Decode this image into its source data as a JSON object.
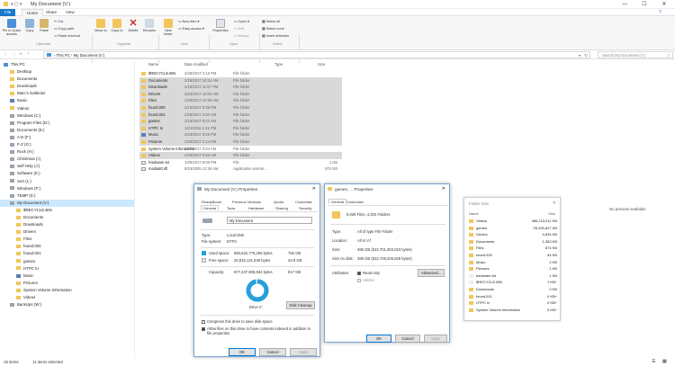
{
  "window": {
    "title": "My Document (V:)",
    "minimize": "—",
    "maximize": "☐",
    "close": "✕"
  },
  "tabs": [
    "File",
    "Home",
    "Share",
    "View"
  ],
  "ribbon": {
    "pin": "Pin to Quick access",
    "copy": "Copy",
    "paste": "Paste",
    "cut": "Cut",
    "copy_path": "Copy path",
    "paste_shortcut": "Paste shortcut",
    "move_to": "Move to",
    "copy_to": "Copy to",
    "delete": "Delete",
    "rename": "Rename",
    "new_folder": "New folder",
    "new_item": "New item ▾",
    "easy_access": "Easy access ▾",
    "properties": "Properties",
    "open": "Open ▾",
    "edit": "Edit",
    "history": "History",
    "select_all": "Select all",
    "select_none": "Select none",
    "invert_selection": "Invert selection",
    "groups": [
      "Clipboard",
      "Organize",
      "New",
      "Open",
      "Select"
    ]
  },
  "address": {
    "path": "› This PC › My Document (V:)",
    "search_placeholder": "Search My Document (V:)"
  },
  "nav": [
    {
      "label": "This PC",
      "kind": "pc",
      "indent": 0
    },
    {
      "label": "Desktop",
      "kind": "folder",
      "indent": 1
    },
    {
      "label": "Documents",
      "kind": "folder",
      "indent": 1
    },
    {
      "label": "Downloads",
      "kind": "folder",
      "indent": 1
    },
    {
      "label": "Marc's Galleries",
      "kind": "folder",
      "indent": 1
    },
    {
      "label": "Music",
      "kind": "music",
      "indent": 1
    },
    {
      "label": "Videos",
      "kind": "folder",
      "indent": 1
    },
    {
      "label": "Windows (C:)",
      "kind": "drive",
      "indent": 1
    },
    {
      "label": "Program Files (D:)",
      "kind": "drive",
      "indent": 1
    },
    {
      "label": "Documents (E:)",
      "kind": "drive",
      "indent": 1
    },
    {
      "label": "A-E (F:)",
      "kind": "drive",
      "indent": 1
    },
    {
      "label": "F-Z (G:)",
      "kind": "drive",
      "indent": 1
    },
    {
      "label": "Rock (H:)",
      "kind": "drive",
      "indent": 1
    },
    {
      "label": "Christmas (I:)",
      "kind": "drive",
      "indent": 1
    },
    {
      "label": "Self Help (J:)",
      "kind": "drive",
      "indent": 1
    },
    {
      "label": "Software (K:)",
      "kind": "drive",
      "indent": 1
    },
    {
      "label": "Sort (L:)",
      "kind": "drive",
      "indent": 1
    },
    {
      "label": "Windows (P:)",
      "kind": "drive",
      "indent": 1
    },
    {
      "label": "TEMP (S:)",
      "kind": "drive",
      "indent": 1
    },
    {
      "label": "My Document (V:)",
      "kind": "drive",
      "indent": 1,
      "selected": true
    },
    {
      "label": "$RECYCLE.BIN",
      "kind": "folder",
      "indent": 2
    },
    {
      "label": "Documents",
      "kind": "folder",
      "indent": 2
    },
    {
      "label": "Downloads",
      "kind": "folder",
      "indent": 2
    },
    {
      "label": "Drivers",
      "kind": "folder",
      "indent": 2
    },
    {
      "label": "Files",
      "kind": "folder",
      "indent": 2
    },
    {
      "label": "found.000",
      "kind": "folder",
      "indent": 2
    },
    {
      "label": "found.001",
      "kind": "folder",
      "indent": 2
    },
    {
      "label": "games",
      "kind": "folder",
      "indent": 2
    },
    {
      "label": "HTPC In",
      "kind": "folder",
      "indent": 2
    },
    {
      "label": "Music",
      "kind": "music",
      "indent": 2
    },
    {
      "label": "Pictures",
      "kind": "folder",
      "indent": 2
    },
    {
      "label": "System Volume Information",
      "kind": "folder",
      "indent": 2
    },
    {
      "label": "Videos",
      "kind": "folder",
      "indent": 2
    },
    {
      "label": "BackUps (W:)",
      "kind": "drive",
      "indent": 1
    }
  ],
  "columns": {
    "name": "Name",
    "date": "Date modified",
    "type": "Type",
    "size": "Size"
  },
  "files": [
    {
      "name": "$RECYCLE.BIN",
      "date": "2/28/2017 2:15 PM",
      "type": "File folder",
      "size": "",
      "sel": false,
      "kind": "folder"
    },
    {
      "name": "Documents",
      "date": "2/26/2017 10:24 AM",
      "type": "File folder",
      "size": "",
      "sel": true,
      "kind": "folder"
    },
    {
      "name": "Downloads",
      "date": "2/16/2017 11:57 PM",
      "type": "File folder",
      "size": "",
      "sel": true,
      "kind": "folder"
    },
    {
      "name": "Drivers",
      "date": "2/24/2017 10:04 AM",
      "type": "File folder",
      "size": "",
      "sel": true,
      "kind": "folder"
    },
    {
      "name": "Files",
      "date": "2/26/2017 10:28 AM",
      "type": "File folder",
      "size": "",
      "sel": true,
      "kind": "folder"
    },
    {
      "name": "found.000",
      "date": "2/16/2017 8:38 PM",
      "type": "File folder",
      "size": "",
      "sel": true,
      "kind": "folder"
    },
    {
      "name": "found.001",
      "date": "2/26/2017 3:02 AM",
      "type": "File folder",
      "size": "",
      "sel": true,
      "kind": "folder"
    },
    {
      "name": "games",
      "date": "2/15/2017 8:22 AM",
      "type": "File folder",
      "size": "",
      "sel": true,
      "kind": "folder"
    },
    {
      "name": "HTPC In",
      "date": "12/1/2016 1:21 PM",
      "type": "File folder",
      "size": "",
      "sel": true,
      "kind": "folder"
    },
    {
      "name": "Music",
      "date": "2/23/2017 8:25 PM",
      "type": "File folder",
      "size": "",
      "sel": true,
      "kind": "music"
    },
    {
      "name": "Pictures",
      "date": "2/26/2017 2:14 PM",
      "type": "File folder",
      "size": "",
      "sel": true,
      "kind": "folder"
    },
    {
      "name": "System Volume Information",
      "date": "2/27/2017 3:04 AM",
      "type": "File folder",
      "size": "",
      "sel": false,
      "kind": "folder"
    },
    {
      "name": "Videos",
      "date": "2/25/2017 5:56 AM",
      "type": "File folder",
      "size": "",
      "sel": true,
      "kind": "folder"
    },
    {
      "name": "hardware.txt",
      "date": "10/6/2017 9:08 PM",
      "type": "File",
      "size": "1 KB",
      "sel": false,
      "kind": "file"
    },
    {
      "name": "msdia80.dll",
      "date": "9/23/2005 12:36 AM",
      "type": "Application extens...",
      "size": "874 KB",
      "sel": false,
      "kind": "file"
    }
  ],
  "status": {
    "items": "15 items",
    "selected": "11 items selected"
  },
  "drive_props": {
    "title": "My Document (V:) Properties",
    "tabs_row1": [
      "ReadyBoost",
      "Previous Versions",
      "Quota",
      "Customize"
    ],
    "tabs_row2": [
      "General",
      "Tools",
      "Hardware",
      "Sharing",
      "Security"
    ],
    "name": "My Document",
    "type_label": "Type:",
    "type_value": "Local Disk",
    "fs_label": "File system:",
    "fs_value": "NTFS",
    "used_label": "Used space:",
    "used_bytes": "850,622,775,296 bytes",
    "used_gb": "792 GB",
    "free_label": "Free space:",
    "free_bytes": "26,815,131,648 bytes",
    "free_gb": "24.9 GB",
    "cap_label": "Capacity:",
    "cap_bytes": "877,437,906,944 bytes",
    "cap_gb": "817 GB",
    "used_fraction": 0.969,
    "drive_label": "Drive V:",
    "cleanup": "Disk Cleanup",
    "compress": "Compress this drive to save disk space",
    "index": "Allow files on this drive to have contents indexed in addition to file properties",
    "ok": "OK",
    "cancel": "Cancel",
    "apply": "Apply",
    "colors": {
      "used": "#26a0da",
      "free": "#e6e6e6"
    }
  },
  "folder_props": {
    "title": "games, ... Properties",
    "tabs": [
      "General",
      "Customize"
    ],
    "summary": "9,029 Files, 4,302 Folders",
    "type_label": "Type:",
    "type_value": "All of type File Folder",
    "loc_label": "Location:",
    "loc_value": "All in V:\\",
    "size_label": "Size:",
    "size_value": "486 GB (522,701,303,023 bytes)",
    "disk_label": "Size on disk:",
    "disk_value": "486 GB (522,749,206,528 bytes)",
    "attr_label": "Attributes:",
    "readonly": "Read-only",
    "hidden": "Hidden",
    "advanced": "Advanced...",
    "ok": "OK",
    "cancel": "Cancel",
    "apply": "Apply"
  },
  "preview": {
    "text": "No preview available."
  },
  "folder_size": {
    "title": "Folder Size",
    "col_name": "Name",
    "col_size": "Size",
    "rows": [
      {
        "name": "Videos",
        "size": "485,215,011 KB"
      },
      {
        "name": "games",
        "size": "25,259,827 KB"
      },
      {
        "name": "Drivers",
        "size": "4,634 KB"
      },
      {
        "name": "Documents",
        "size": "1,353 KB"
      },
      {
        "name": "Files",
        "size": "874 KB"
      },
      {
        "name": "found.000",
        "size": "64 KB"
      },
      {
        "name": "Music",
        "size": "2 KB"
      },
      {
        "name": "Pictures",
        "size": "1 KB"
      },
      {
        "name": "hardware.txt",
        "size": "1 KB"
      },
      {
        "name": "$RECYCLE.BIN",
        "size": "1 KB+"
      },
      {
        "name": "Downloads",
        "size": "0 KB"
      },
      {
        "name": "found.001",
        "size": "0 KB+"
      },
      {
        "name": "HTPC In",
        "size": "0 KB+"
      },
      {
        "name": "System Volume Information",
        "size": "0 KB+"
      }
    ]
  }
}
